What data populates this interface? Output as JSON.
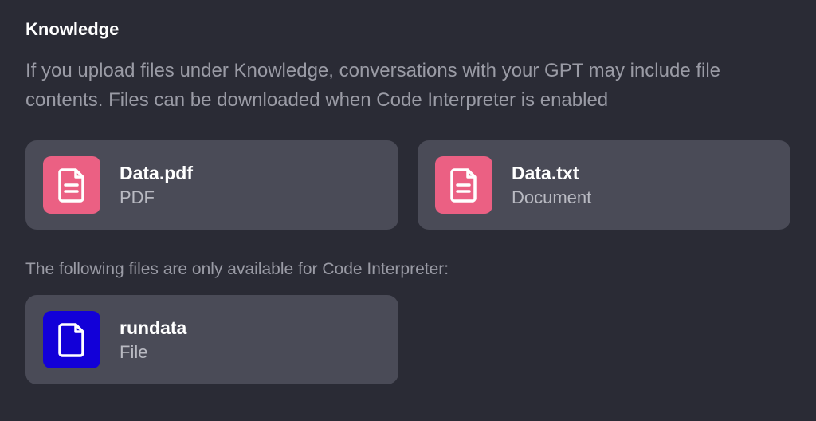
{
  "section": {
    "title": "Knowledge",
    "description": "If you upload files under Knowledge, conversations with your GPT may include file contents. Files can be downloaded when Code Interpreter is enabled"
  },
  "files": [
    {
      "name": "Data.pdf",
      "type": "PDF",
      "icon_color": "pink",
      "icon_kind": "document"
    },
    {
      "name": "Data.txt",
      "type": "Document",
      "icon_color": "pink",
      "icon_kind": "document"
    }
  ],
  "code_interpreter_note": "The following files are only available for Code Interpreter:",
  "ci_files": [
    {
      "name": "rundata",
      "type": "File",
      "icon_color": "blue",
      "icon_kind": "file"
    }
  ]
}
